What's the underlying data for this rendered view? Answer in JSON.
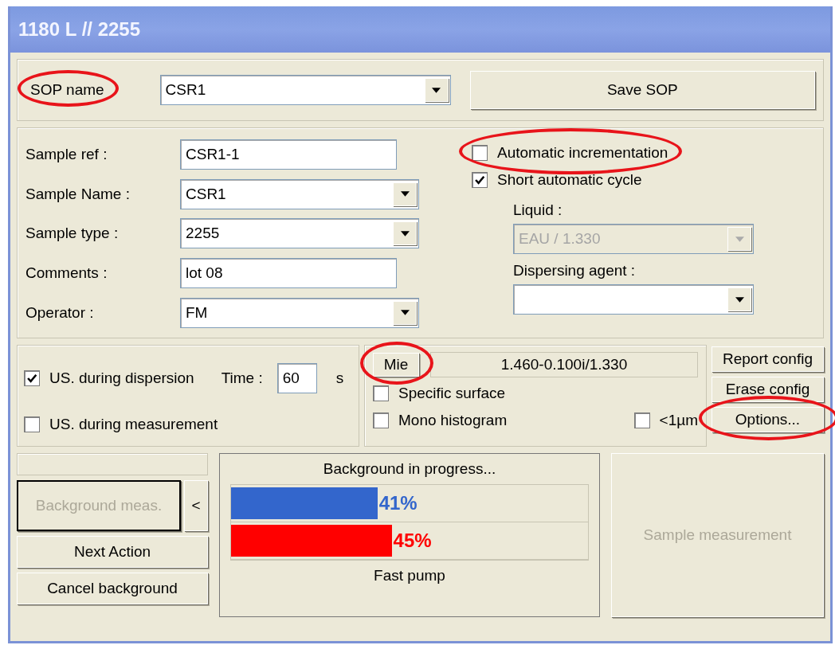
{
  "window": {
    "title": "1180 L // 2255"
  },
  "sop": {
    "label": "SOP name",
    "label_highlighted": true,
    "value": "CSR1",
    "save_button": "Save SOP"
  },
  "sample_fields": [
    {
      "label": "Sample ref :",
      "value": "CSR1-1",
      "kind": "text"
    },
    {
      "label": "Sample Name :",
      "value": "CSR1",
      "kind": "combo"
    },
    {
      "label": "Sample type :",
      "value": "2255",
      "kind": "combo"
    },
    {
      "label": "Comments :",
      "value": "lot 08",
      "kind": "text"
    },
    {
      "label": "Operator :",
      "value": "FM",
      "kind": "combo"
    }
  ],
  "cycle_options": [
    {
      "label": "Automatic incrementation",
      "checked": false,
      "highlighted": true
    },
    {
      "label": "Short automatic cycle",
      "checked": true,
      "highlighted": false
    }
  ],
  "liquid": {
    "label": "Liquid :",
    "value": "EAU / 1.330",
    "disabled": true
  },
  "dispersing_agent": {
    "label": "Dispersing agent :"
  },
  "ultrasound": {
    "checks": [
      {
        "label": "US. during dispersion",
        "checked": true
      },
      {
        "label": "US. during measurement",
        "checked": false
      }
    ],
    "time_label": "Time :",
    "time_value": "60",
    "time_unit": "s"
  },
  "optical": {
    "model_button": "Mie",
    "model_highlighted": true,
    "refractive_index": "1.460-0.100i/1.330",
    "checks": [
      {
        "label": "Specific surface",
        "checked": false
      },
      {
        "label": "Mono histogram",
        "checked": false
      },
      {
        "label": "<1µm",
        "checked": false
      }
    ]
  },
  "config_buttons": [
    {
      "label": "Report config",
      "highlighted": false
    },
    {
      "label": "Erase config",
      "highlighted": false
    },
    {
      "label": "Options...",
      "highlighted": true
    }
  ],
  "actions": {
    "measure_button": {
      "label": "Background meas.",
      "disabled": true
    },
    "collapse_button": "<",
    "buttons": [
      {
        "label": "Next Action"
      },
      {
        "label": "Cancel background"
      }
    ]
  },
  "progress": {
    "title": "Background in progress...",
    "bars": [
      {
        "level": 0.41,
        "reading": "41%",
        "color": "#3366cc"
      },
      {
        "level": 0.45,
        "reading": "45%",
        "color": "#ff0000"
      }
    ],
    "status": "Fast pump"
  },
  "sample_button": {
    "label": "Sample measurement",
    "disabled": true
  }
}
